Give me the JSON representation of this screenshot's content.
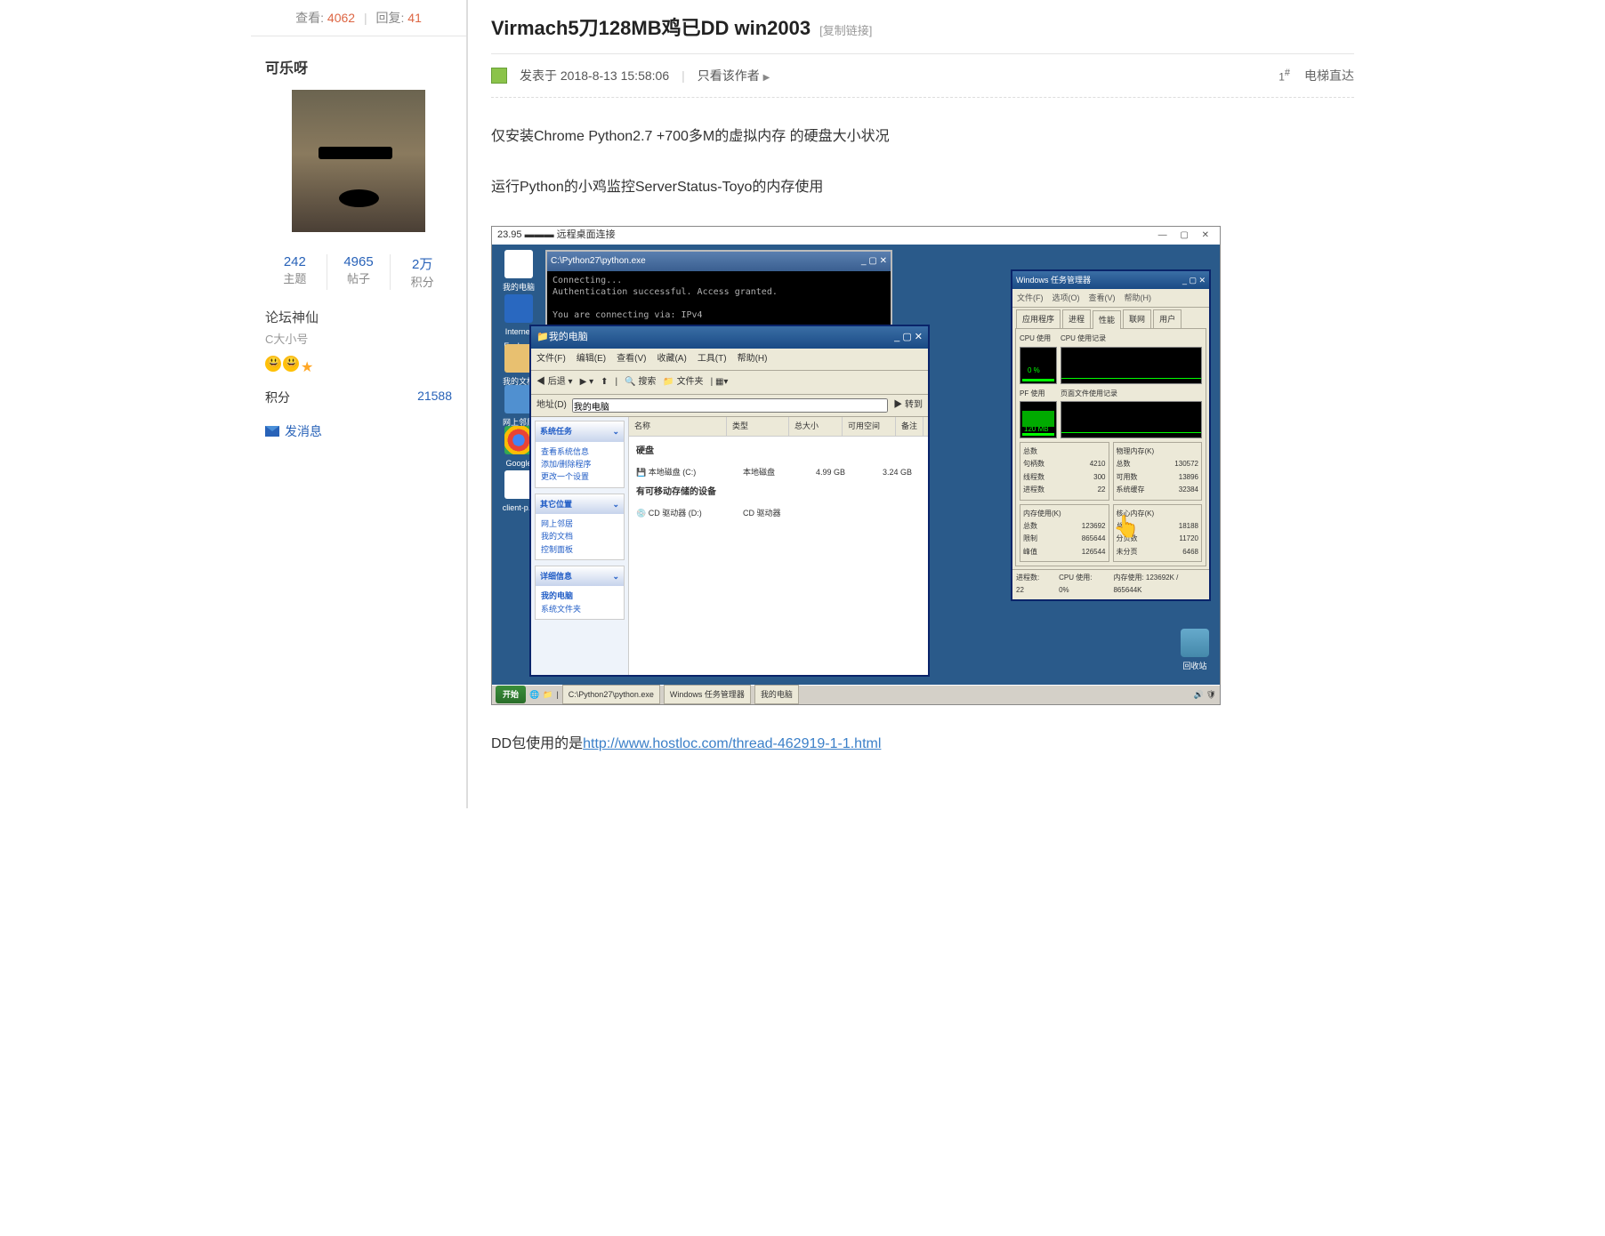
{
  "sidebar": {
    "views_label": "查看:",
    "views": "4062",
    "replies_label": "回复:",
    "replies": "41",
    "username": "可乐呀",
    "stats": {
      "topics_num": "242",
      "topics_lbl": "主题",
      "posts_num": "4965",
      "posts_lbl": "帖子",
      "points_num": "2万",
      "points_lbl": "积分"
    },
    "rank": "论坛神仙",
    "subtitle": "C大小号",
    "points_label": "积分",
    "points_value": "21588",
    "msg_link": "发消息"
  },
  "thread": {
    "title": "Virmach5刀128MB鸡已DD win2003",
    "copy_link": "[复制链接]",
    "posted_prefix": "发表于",
    "posted_at": "2018-8-13 15:58:06",
    "only_author": "只看该作者",
    "floor": "1",
    "elevator": "电梯直达"
  },
  "post": {
    "p1": "仅安装Chrome Python2.7 +700多M的虚拟内存 的硬盘大小状况",
    "p2": "运行Python的小鸡监控ServerStatus-Toyo的内存使用",
    "p3_prefix": "DD包使用的是",
    "p3_link": "http://www.hostloc.com/thread-462919-1-1.html"
  },
  "ss": {
    "rdp_title": "23.95 ▬▬▬ 远程桌面连接",
    "desk": {
      "mycomp": "我的电脑",
      "ie": "Internet Explorer",
      "docs": "我的文档",
      "net": "网上邻居",
      "chrome": "Google Chrome",
      "client": "client-p...",
      "recycle": "回收站"
    },
    "cmd": {
      "title": "C:\\Python27\\python.exe",
      "l1": "Connecting...",
      "l2": "Authentication successful. Access granted.",
      "l3": "You are connecting via: IPv4"
    },
    "exp": {
      "title": "我的电脑",
      "menu": {
        "file": "文件(F)",
        "edit": "编辑(E)",
        "view": "查看(V)",
        "fav": "收藏(A)",
        "tools": "工具(T)",
        "help": "帮助(H)"
      },
      "tb": {
        "back": "后退",
        "search": "搜索",
        "folders": "文件夹"
      },
      "addr_lbl": "地址(D)",
      "addr_val": "我的电脑",
      "go": "转到",
      "cols": {
        "name": "名称",
        "type": "类型",
        "total": "总大小",
        "free": "可用空间",
        "note": "备注"
      },
      "side": {
        "tasks_h": "系统任务",
        "t1": "查看系统信息",
        "t2": "添加/删除程序",
        "t3": "更改一个设置",
        "places_h": "其它位置",
        "p1": "网上邻居",
        "p2": "我的文档",
        "p3": "控制面板",
        "details_h": "详细信息",
        "d1": "我的电脑",
        "d2": "系统文件夹"
      },
      "sec_hdd": "硬盘",
      "hdd_name": "本地磁盘 (C:)",
      "hdd_type": "本地磁盘",
      "hdd_total": "4.99 GB",
      "hdd_free": "3.24 GB",
      "sec_rem": "有可移动存储的设备",
      "cd1": "CD 驱动器 (D:)",
      "cd1_type": "CD 驱动器"
    },
    "tm": {
      "title": "Windows 任务管理器",
      "menu": {
        "file": "文件(F)",
        "opt": "选项(O)",
        "view": "查看(V)",
        "help": "帮助(H)"
      },
      "tabs": {
        "app": "应用程序",
        "proc": "进程",
        "perf": "性能",
        "net": "联网",
        "user": "用户"
      },
      "cpu_lbl": "CPU 使用",
      "cpu_hist": "CPU 使用记录",
      "cpu_val": "0 %",
      "pf_lbl": "PF 使用",
      "pf_hist": "页面文件使用记录",
      "pf_val": "120 MB",
      "totals_h": "总数",
      "handles_l": "句柄数",
      "handles_v": "4210",
      "threads_l": "线程数",
      "threads_v": "300",
      "procs_l": "进程数",
      "procs_v": "22",
      "phys_h": "物理内存(K)",
      "phys_t_l": "总数",
      "phys_t_v": "130572",
      "phys_a_l": "可用数",
      "phys_a_v": "13896",
      "phys_c_l": "系统缓存",
      "phys_c_v": "32384",
      "commit_h": "内存使用(K)",
      "commit_t_l": "总数",
      "commit_t_v": "123692",
      "commit_l_l": "限制",
      "commit_l_v": "865644",
      "commit_p_l": "峰值",
      "commit_p_v": "126544",
      "kernel_h": "核心内存(K)",
      "kern_t_l": "总数",
      "kern_t_v": "18188",
      "kern_p_l": "分页数",
      "kern_p_v": "11720",
      "kern_n_l": "未分页",
      "kern_n_v": "6468",
      "status_p": "进程数: 22",
      "status_c": "CPU 使用: 0%",
      "status_m": "内存使用: 123692K / 865644K"
    },
    "taskbar": {
      "start": "开始",
      "t1": "C:\\Python27\\python.exe",
      "t2": "Windows 任务管理器",
      "t3": "我的电脑"
    }
  }
}
